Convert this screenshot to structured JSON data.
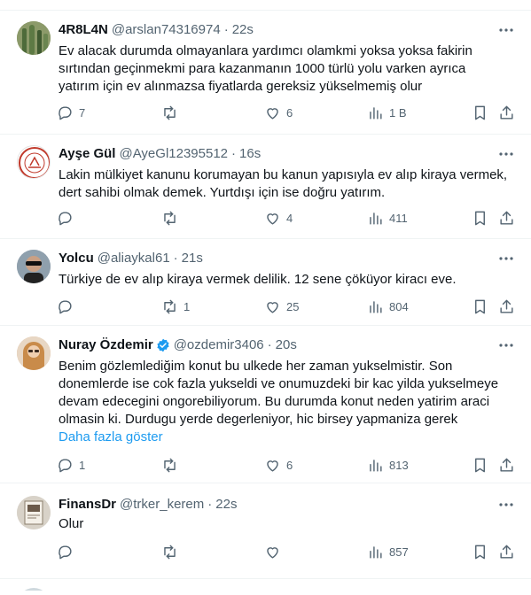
{
  "tweets": [
    {
      "name": "4R8L4N",
      "handle": "@arslan74316974",
      "time": "22s",
      "text_lines": [
        "Ev alacak durumda olmayanlara yardımcı olamkmi yoksa yoksa fakirin",
        "sırtından geçinmekmi para kazanmanın 1000 türlü yolu varken ayrıca",
        "yatırım için ev alınmazsa fiyatlarda gereksiz yükselmemiş olur"
      ],
      "replies": "7",
      "retweets": "",
      "likes": "6",
      "views": "1 B",
      "avatar": "cactus-avatar"
    },
    {
      "name": "Ayşe Gül",
      "handle": "@AyeGl12395512",
      "time": "16s",
      "text_lines": [
        "Lakin mülkiyet kanunu korumayan bu kanun yapısıyla ev alıp kiraya vermek,",
        "dert sahibi olmak demek. Yurtdışı için ise doğru yatırım."
      ],
      "replies": "",
      "retweets": "",
      "likes": "4",
      "views": "411",
      "avatar": "seal-avatar"
    },
    {
      "name": "Yolcu",
      "handle": "@aliaykal61",
      "time": "21s",
      "text_lines": [
        "Türkiye de ev alıp kiraya vermek delilik. 12 sene çöküyor kiracı eve."
      ],
      "replies": "",
      "retweets": "1",
      "likes": "25",
      "views": "804",
      "avatar": "sunglasses-avatar"
    },
    {
      "name": "Nuray Özdemir",
      "handle": "@ozdemir3406",
      "time": "20s",
      "text_lines": [
        "Benim gözlemlediğim konut bu ulkede her zaman yukselmistir. Son",
        "donemlerde ise cok fazla yukseldi ve onumuzdeki bir kac yilda yukselmeye",
        "devam edecegini ongorebiliyorum. Bu durumda konut neden yatirim araci",
        "olmasin ki. Durdugu yerde degerleniyor, hic birsey yapmaniza gerek"
      ],
      "show_more": "Daha fazla göster",
      "replies": "1",
      "retweets": "",
      "likes": "6",
      "views": "813",
      "avatar": "woman-avatar"
    },
    {
      "name": "FinansDr",
      "handle": "@trker_kerem",
      "time": "22s",
      "text_lines": [
        "Olur"
      ],
      "replies": "",
      "retweets": "",
      "likes": "",
      "views": "857",
      "avatar": "book-avatar"
    }
  ],
  "colors": {
    "text": "#0f1419",
    "muted": "#536471",
    "link": "#1d9bf0",
    "verified": "#1d9bf0",
    "divider": "#eff3f4"
  },
  "icons": [
    "reply-icon",
    "retweet-icon",
    "like-icon",
    "views-icon",
    "bookmark-icon",
    "share-icon",
    "more-icon",
    "verified-badge-icon"
  ]
}
